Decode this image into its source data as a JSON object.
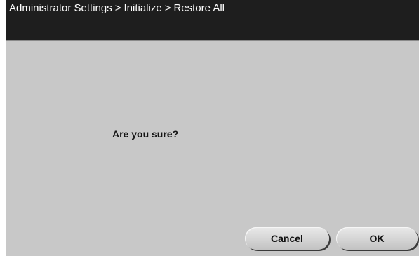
{
  "header": {
    "breadcrumb": [
      "Administrator Settings",
      "Initialize",
      "Restore All"
    ],
    "separator": ">"
  },
  "dialog": {
    "message": "Are you sure?"
  },
  "buttons": {
    "cancel_label": "Cancel",
    "ok_label": "OK"
  },
  "colors": {
    "header_bg": "#1e1e1e",
    "panel_bg": "#c8c8c8",
    "text_light": "#ffffff",
    "text_dark": "#141414"
  }
}
